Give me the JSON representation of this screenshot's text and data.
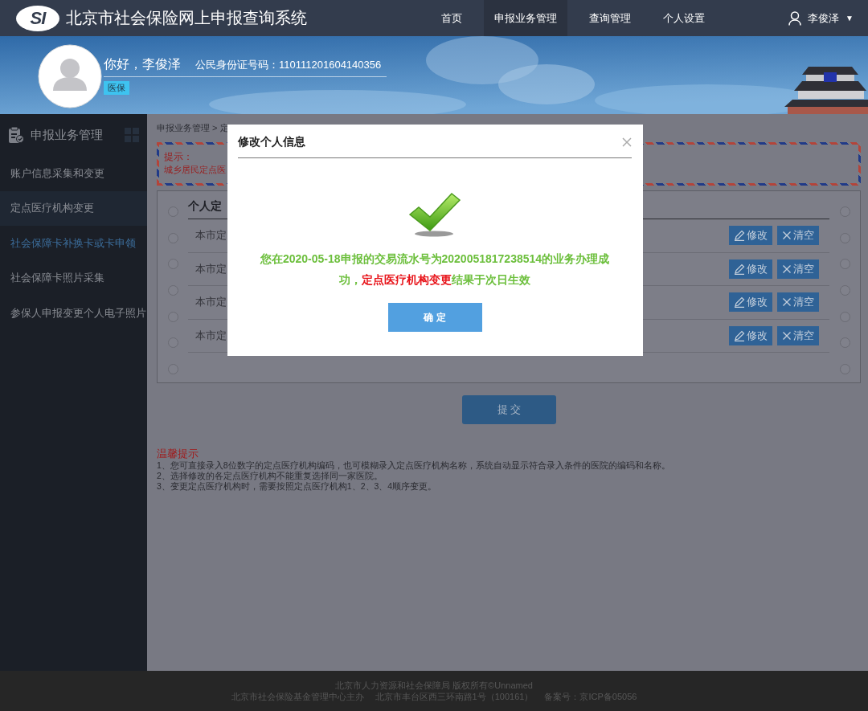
{
  "header": {
    "logo_text": "SI",
    "title": "北京市社会保险网上申报查询系统",
    "nav": [
      {
        "label": "首页",
        "selected": false
      },
      {
        "label": "申报业务管理",
        "selected": true
      },
      {
        "label": "查询管理",
        "selected": false
      },
      {
        "label": "个人设置",
        "selected": false
      }
    ],
    "user": {
      "name": "李俊泽",
      "caret": "▼"
    }
  },
  "banner": {
    "greeting": "你好，李俊泽",
    "id_label": "公民身份证号码：110111201604140356",
    "tag": "医保"
  },
  "sidebar": {
    "title": "申报业务管理",
    "items": [
      {
        "label": "账户信息采集和变更",
        "selected": false,
        "highlighted": false
      },
      {
        "label": "定点医疗机构变更",
        "selected": true,
        "highlighted": false
      },
      {
        "label": "社会保障卡补换卡或卡申领",
        "selected": false,
        "highlighted": true
      },
      {
        "label": "社会保障卡照片采集",
        "selected": false,
        "highlighted": false
      },
      {
        "label": "参保人申报变更个人电子照片",
        "selected": false,
        "highlighted": false
      }
    ]
  },
  "breadcrumb": "申报业务管理 > 定",
  "notice": {
    "title": "提示：",
    "text": "城乡居民定点医"
  },
  "panel": {
    "heading": "个人定",
    "rows": [
      {
        "text": "本市定",
        "edit": "修改",
        "clear": "清空"
      },
      {
        "text": "本市定",
        "edit": "修改",
        "clear": "清空"
      },
      {
        "text": "本市定",
        "edit": "修改",
        "clear": "清空"
      },
      {
        "text": "本市定",
        "edit": "修改",
        "clear": "清空"
      }
    ],
    "radios_left": [
      {
        "selected": false
      },
      {
        "selected": false
      },
      {
        "selected": false
      },
      {
        "selected": false
      },
      {
        "selected": false
      },
      {
        "selected": false
      },
      {
        "selected": false
      }
    ],
    "radios_right": [
      {
        "selected": false
      },
      {
        "selected": false
      },
      {
        "selected": false
      },
      {
        "selected": false
      },
      {
        "selected": false
      },
      {
        "selected": false
      },
      {
        "selected": false
      }
    ]
  },
  "submit": "提 交",
  "tips": {
    "title": "温馨提示",
    "lines": [
      "1、您可直接录入8位数字的定点医疗机构编码，也可模糊录入定点医疗机构名称，系统自动显示符合录入条件的医院的编码和名称。",
      "2、选择修改的各定点医疗机构不能重复选择同一家医院。",
      "3、变更定点医疗机构时，需要按照定点医疗机构1、2、3、4顺序变更。"
    ]
  },
  "modal": {
    "title": "修改个人信息",
    "message": [
      {
        "kind": "normal",
        "text": "您在2020-05-18申报的交易流水号为2020051817238514的业务办理成功，"
      },
      {
        "kind": "highlight",
        "text": "定点医疗机构变更"
      },
      {
        "kind": "normal",
        "text": "结果于次日生效"
      }
    ],
    "confirm": "确 定"
  },
  "footer": {
    "lines": [
      "北京市人力资源和社会保障局 版权所有©Unnamed",
      "北京市社会保险基金管理中心主办　 北京市丰台区西三环南路1号（100161）　 备案号：京ICP备05056"
    ]
  }
}
